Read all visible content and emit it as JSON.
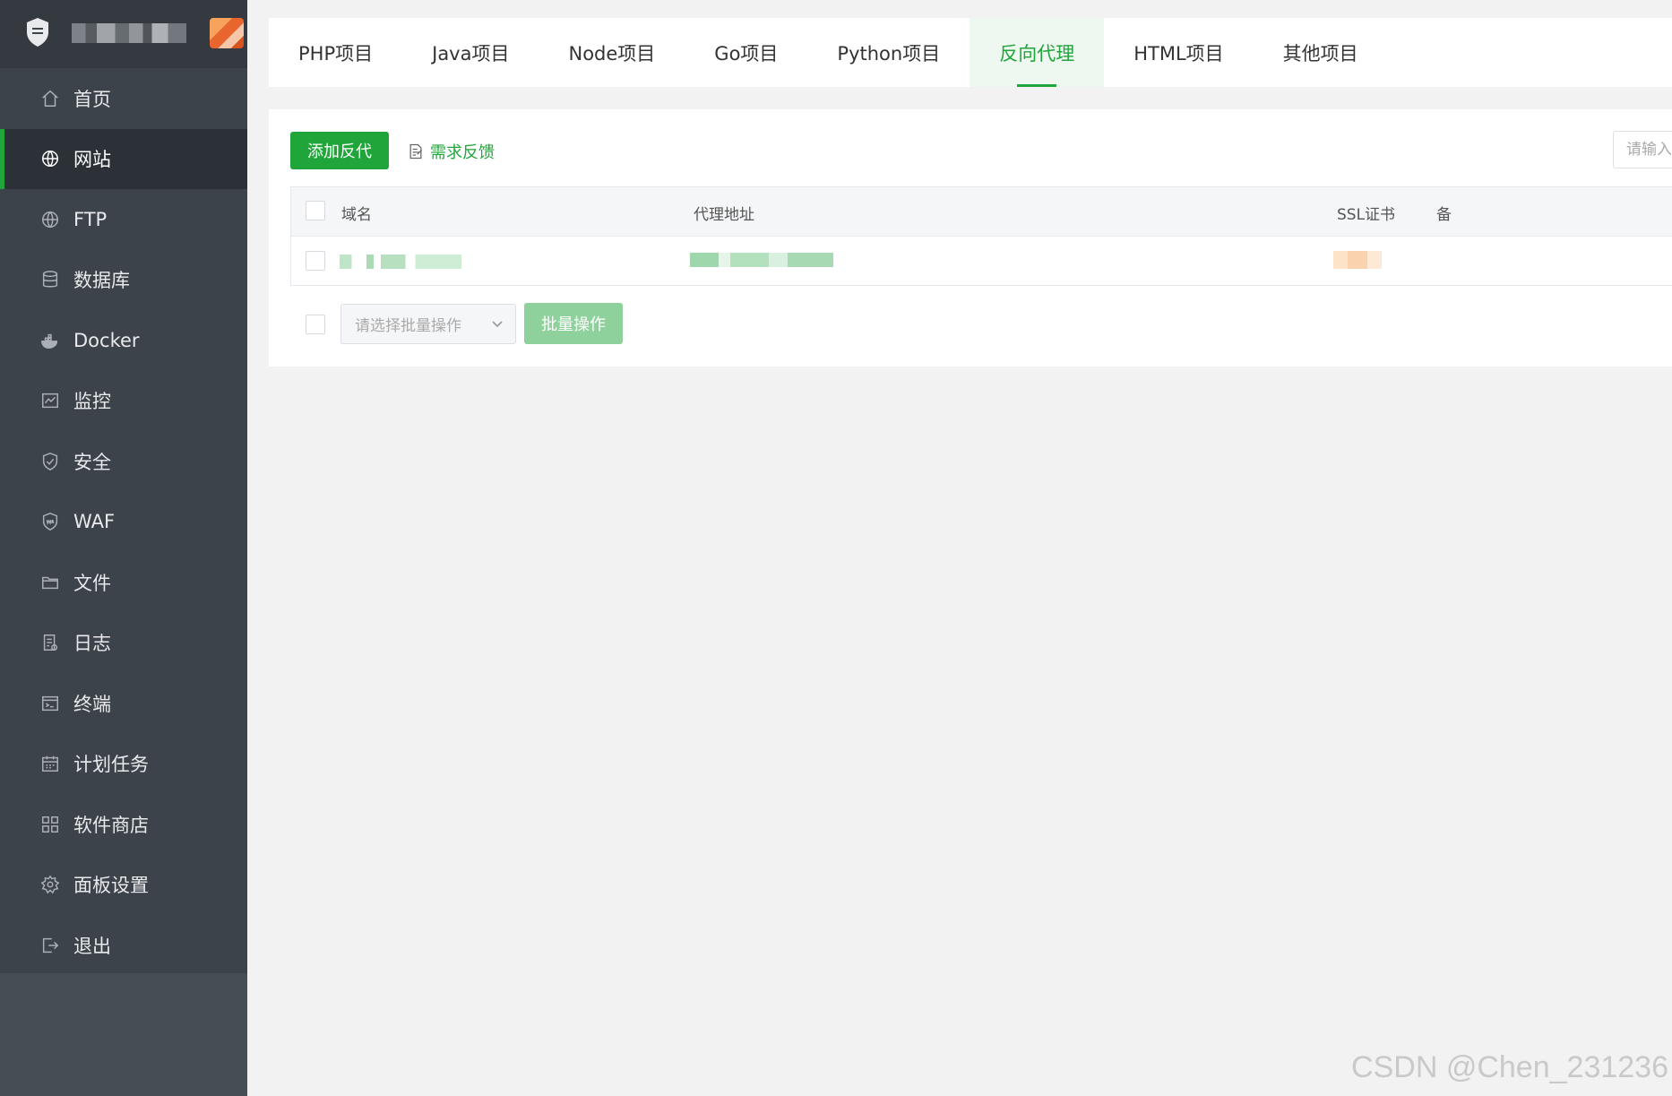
{
  "sidebar": {
    "items": [
      {
        "label": "首页",
        "icon": "home-icon",
        "active": false
      },
      {
        "label": "网站",
        "icon": "globe-icon",
        "active": true
      },
      {
        "label": "FTP",
        "icon": "ftp-globe-icon",
        "active": false
      },
      {
        "label": "数据库",
        "icon": "database-icon",
        "active": false
      },
      {
        "label": "Docker",
        "icon": "docker-icon",
        "active": false
      },
      {
        "label": "监控",
        "icon": "monitor-icon",
        "active": false
      },
      {
        "label": "安全",
        "icon": "shield-icon",
        "active": false
      },
      {
        "label": "WAF",
        "icon": "waf-shield-icon",
        "active": false
      },
      {
        "label": "文件",
        "icon": "folder-icon",
        "active": false
      },
      {
        "label": "日志",
        "icon": "log-icon",
        "active": false
      },
      {
        "label": "终端",
        "icon": "terminal-icon",
        "active": false
      },
      {
        "label": "计划任务",
        "icon": "calendar-icon",
        "active": false
      },
      {
        "label": "软件商店",
        "icon": "apps-icon",
        "active": false
      },
      {
        "label": "面板设置",
        "icon": "gear-icon",
        "active": false
      },
      {
        "label": "退出",
        "icon": "logout-icon",
        "active": false
      }
    ]
  },
  "tabs": [
    {
      "label": "PHP项目",
      "active": false
    },
    {
      "label": "Java项目",
      "active": false
    },
    {
      "label": "Node项目",
      "active": false
    },
    {
      "label": "Go项目",
      "active": false
    },
    {
      "label": "Python项目",
      "active": false
    },
    {
      "label": "反向代理",
      "active": true
    },
    {
      "label": "HTML项目",
      "active": false
    },
    {
      "label": "其他项目",
      "active": false
    }
  ],
  "toolbar": {
    "add_label": "添加反代",
    "feedback_label": "需求反馈",
    "search_placeholder": "请输入"
  },
  "table": {
    "columns": [
      "域名",
      "代理地址",
      "SSL证书",
      "备"
    ]
  },
  "footer": {
    "batch_select_placeholder": "请选择批量操作",
    "batch_button": "批量操作"
  },
  "watermark": "CSDN @Chen_231236",
  "colors": {
    "accent": "#20a53a",
    "sidebar_bg": "#3d434a",
    "sidebar_active_bg": "#2c3137"
  }
}
